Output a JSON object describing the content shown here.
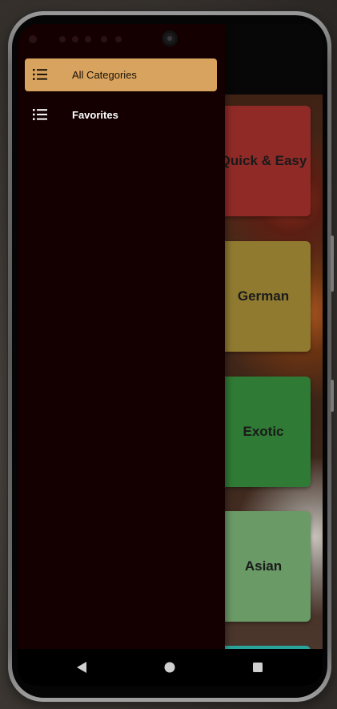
{
  "categories": [
    {
      "label": "Quick & Easy",
      "color": "#8f2a27"
    },
    {
      "label": "German",
      "color": "#8f7a30"
    },
    {
      "label": "Exotic",
      "color": "#2f7a35"
    },
    {
      "label": "Asian",
      "color": "#6a9a66"
    }
  ],
  "drawer": {
    "items": [
      {
        "label": "All Categories",
        "icon": "list-icon",
        "selected": true
      },
      {
        "label": "Favorites",
        "icon": "list-icon",
        "selected": false
      }
    ]
  },
  "colors": {
    "drawer_bg": "#140000",
    "selected_item": "#d8a35f",
    "peek_card": "#2aa39b"
  },
  "nav": {
    "back": "back-triangle-icon",
    "home": "home-circle-icon",
    "recents": "recents-square-icon"
  }
}
